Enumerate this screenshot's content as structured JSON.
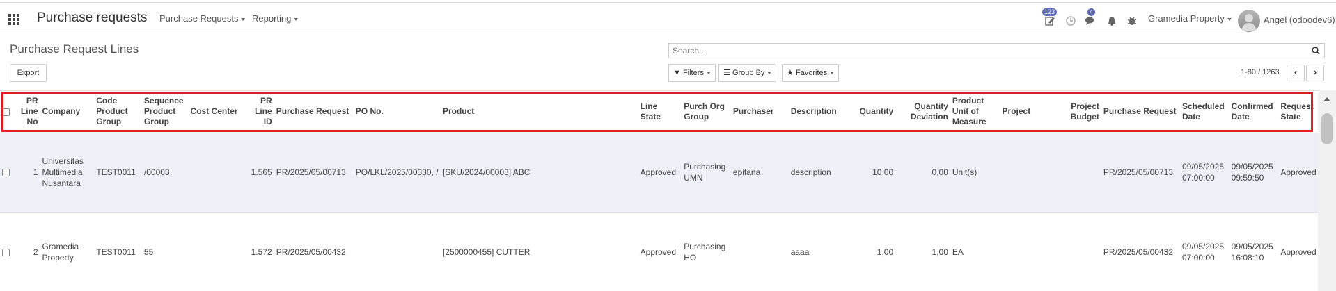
{
  "app": {
    "title": "Purchase requests",
    "menus": [
      "Purchase Requests",
      "Reporting"
    ],
    "badges": {
      "activity": "123",
      "messages": "4"
    },
    "company": "Gramedia Property",
    "user": "Angel (odoodev6)"
  },
  "control": {
    "title": "Purchase Request Lines",
    "export_label": "Export",
    "search_placeholder": "Search...",
    "filters_label": "Filters",
    "groupby_label": "Group By",
    "favorites_label": "Favorites",
    "pager": "1-80 / 1263"
  },
  "table": {
    "columns": [
      "PR Line No",
      "Company",
      "Code Product Group",
      "Sequence Product Group",
      "Cost Center",
      "PR Line ID",
      "Purchase Request",
      "PO No.",
      "Product",
      "Line State",
      "Purch Org Group",
      "Purchaser",
      "Description",
      "Quantity",
      "Quantity Deviation",
      "Product Unit of Measure",
      "Project",
      "Project Budget",
      "Purchase Request",
      "Scheduled Date",
      "Confirmed Date",
      "Request State"
    ],
    "rows": [
      [
        "1",
        "Universitas Multimedia Nusantara",
        "TEST0011",
        "/00003",
        "",
        "1.565",
        "PR/2025/05/00713",
        "PO/LKL/2025/00330, /",
        "[SKU/2024/00003] ABC",
        "Approved",
        "Purchasing UMN",
        "epifana",
        "description",
        "10,00",
        "0,00",
        "Unit(s)",
        "",
        "",
        "PR/2025/05/00713",
        "09/05/2025 07:00:00",
        "09/05/2025 09:59:50",
        "Approved"
      ],
      [
        "2",
        "Gramedia Property",
        "TEST0011",
        "55",
        "",
        "1.572",
        "PR/2025/05/00432",
        "",
        "[2500000455] CUTTER",
        "Approved",
        "Purchasing HO",
        "",
        "aaaa",
        "1,00",
        "1,00",
        "EA",
        "",
        "",
        "PR/2025/05/00432",
        "09/05/2025 07:00:00",
        "09/05/2025 16:08:10",
        "Approved"
      ]
    ]
  },
  "colors": {
    "highlight": "#e01b24",
    "badge": "#5c6ab8",
    "selected_row": "#eef0f7"
  }
}
